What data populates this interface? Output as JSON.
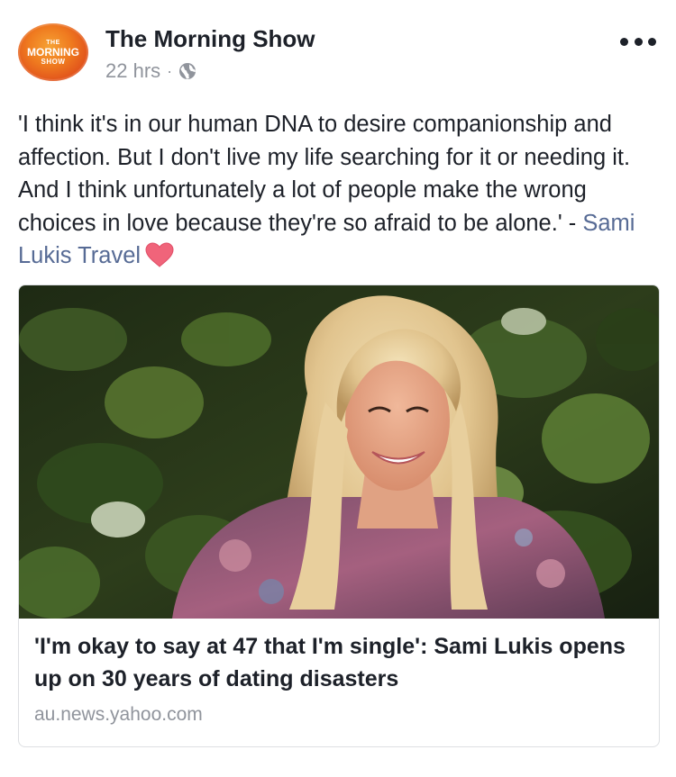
{
  "post": {
    "page_name": "The Morning Show",
    "avatar_logo_text": [
      "THE",
      "MORNING",
      "SHOW"
    ],
    "time": "22 hrs",
    "separator": "·",
    "privacy_icon": "globe-icon",
    "more_icon": "more-options-icon",
    "text": "'I think it's in our human DNA to desire companionship and affection. But I don't live my life searching for it or needing it. And I think unfortunately a lot of people make the wrong choices in love because they're so afraid to be alone.' - ",
    "mention": "Sami Lukis Travel",
    "emoji_icon": "heart-icon"
  },
  "link_card": {
    "title": "'I'm okay to say at 47 that I'm single': Sami Lukis opens up on 30 years of dating disasters",
    "domain": "au.news.yahoo.com",
    "image_icon": "photo-of-woman-smiling"
  },
  "colors": {
    "text": "#1d2129",
    "meta": "#90949c",
    "mention": "#576b95",
    "heart": "#f0647a",
    "avatar_orange": "#ef7a1f"
  }
}
